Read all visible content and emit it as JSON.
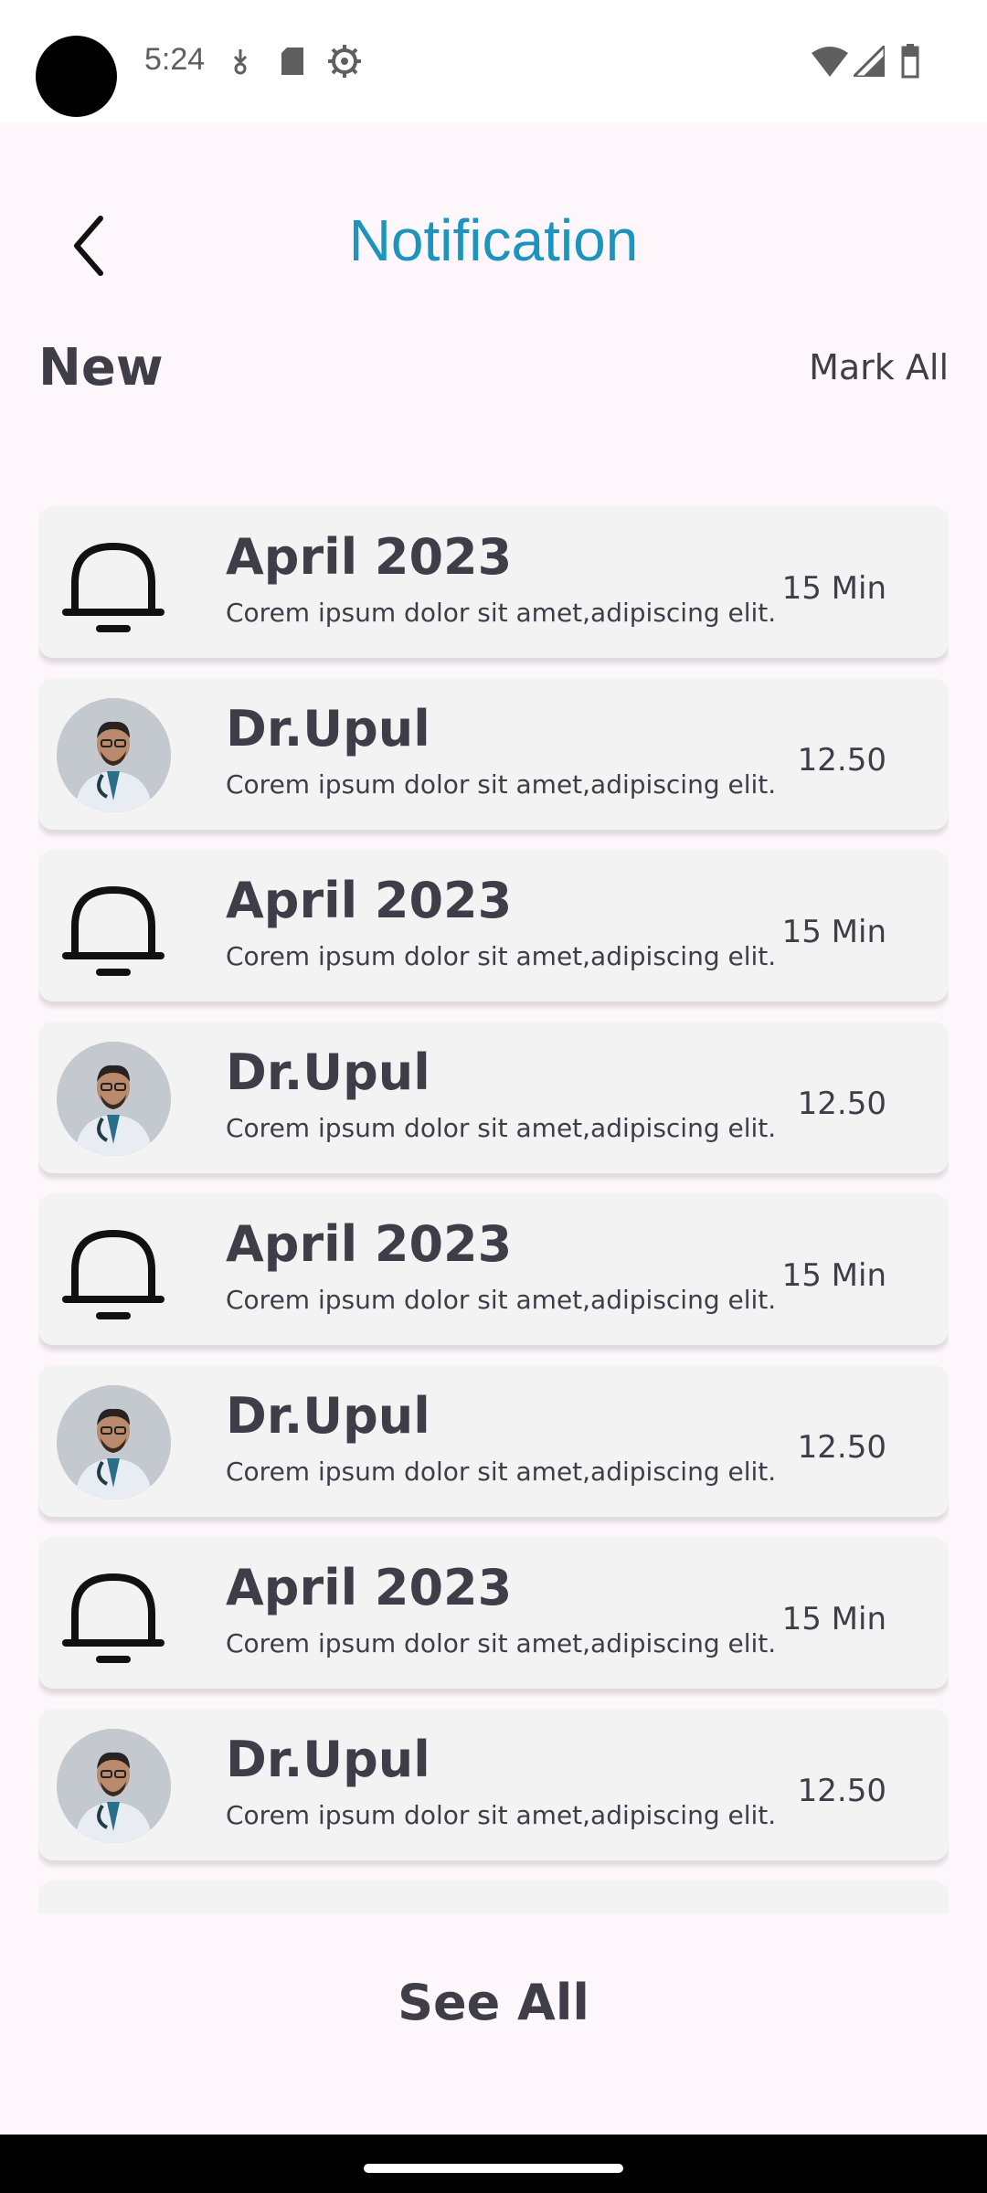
{
  "status_bar": {
    "time": "5:24"
  },
  "header": {
    "title": "Notification"
  },
  "section": {
    "label": "New",
    "mark_all": "Mark All"
  },
  "notifications": [
    {
      "type": "bell",
      "title": "April 2023",
      "desc": "Corem ipsum dolor sit amet,adipiscing elit.",
      "time": "15 Min"
    },
    {
      "type": "avatar",
      "title": "Dr.Upul",
      "desc": "Corem ipsum dolor sit amet,adipiscing elit.",
      "time": "12.50"
    },
    {
      "type": "bell",
      "title": "April 2023",
      "desc": "Corem ipsum dolor sit amet,adipiscing elit.",
      "time": "15 Min"
    },
    {
      "type": "avatar",
      "title": "Dr.Upul",
      "desc": "Corem ipsum dolor sit amet,adipiscing elit.",
      "time": "12.50"
    },
    {
      "type": "bell",
      "title": "April 2023",
      "desc": "Corem ipsum dolor sit amet,adipiscing elit.",
      "time": "15 Min"
    },
    {
      "type": "avatar",
      "title": "Dr.Upul",
      "desc": "Corem ipsum dolor sit amet,adipiscing elit.",
      "time": "12.50"
    },
    {
      "type": "bell",
      "title": "April 2023",
      "desc": "Corem ipsum dolor sit amet,adipiscing elit.",
      "time": "15 Min"
    },
    {
      "type": "avatar",
      "title": "Dr.Upul",
      "desc": "Corem ipsum dolor sit amet,adipiscing elit.",
      "time": "12.50"
    }
  ],
  "footer": {
    "see_all": "See All"
  },
  "colors": {
    "accent": "#1c94bd",
    "text": "#3f3d48",
    "card": "#f3f3f3",
    "background": "#fdf7fb"
  }
}
